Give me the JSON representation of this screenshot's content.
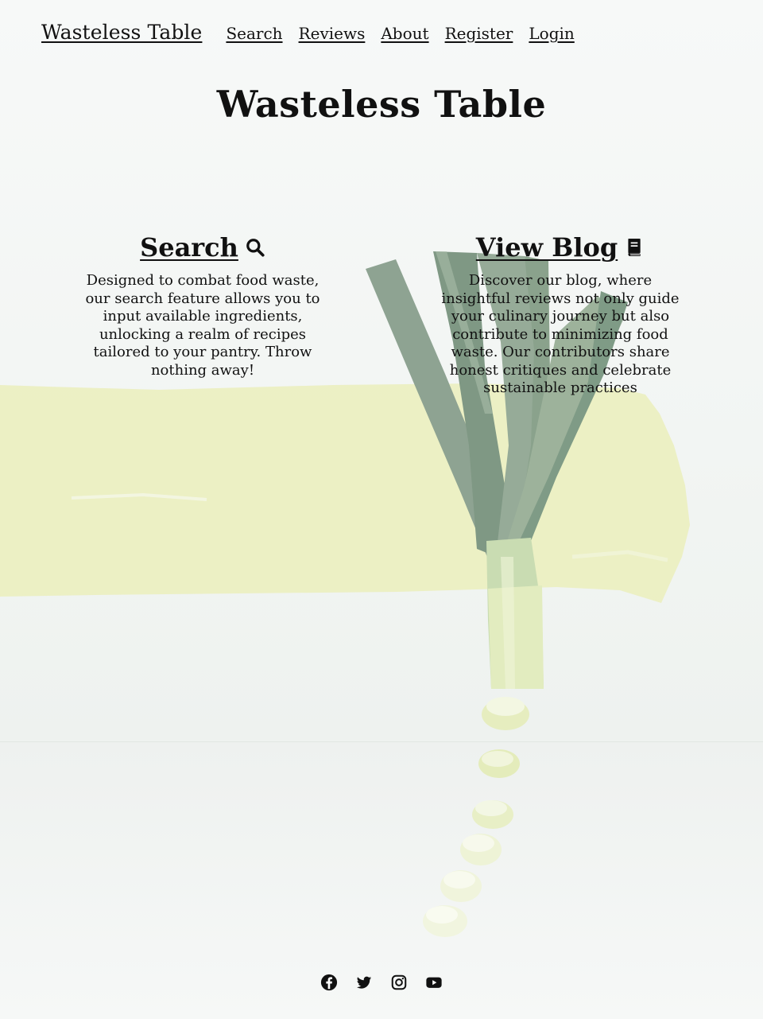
{
  "nav": {
    "brand": "Wasteless Table",
    "links": [
      "Search",
      "Reviews",
      "About",
      "Register",
      "Login"
    ]
  },
  "hero": {
    "title": "Wasteless Table"
  },
  "features": {
    "search": {
      "heading": "Search",
      "icon": "search-icon",
      "text": "Designed to combat food waste, our search feature allows you to input available ingredients, unlocking a realm of recipes tailored to your pantry. Throw nothing away!"
    },
    "blog": {
      "heading": "View Blog",
      "icon": "book-icon",
      "text": "Discover our blog, where insightful reviews not only guide your culinary journey but also contribute to minimizing food waste. Our contributors share honest critiques and celebrate sustainable practices"
    }
  },
  "footer": {
    "social": [
      "facebook-icon",
      "twitter-icon",
      "instagram-icon",
      "youtube-icon"
    ]
  },
  "colors": {
    "text": "#111111",
    "paint_stroke": "#ecefc0",
    "leek_leaf": "#8fa892",
    "leek_stem": "#dfe9b8",
    "background": "#f4f6f4"
  }
}
